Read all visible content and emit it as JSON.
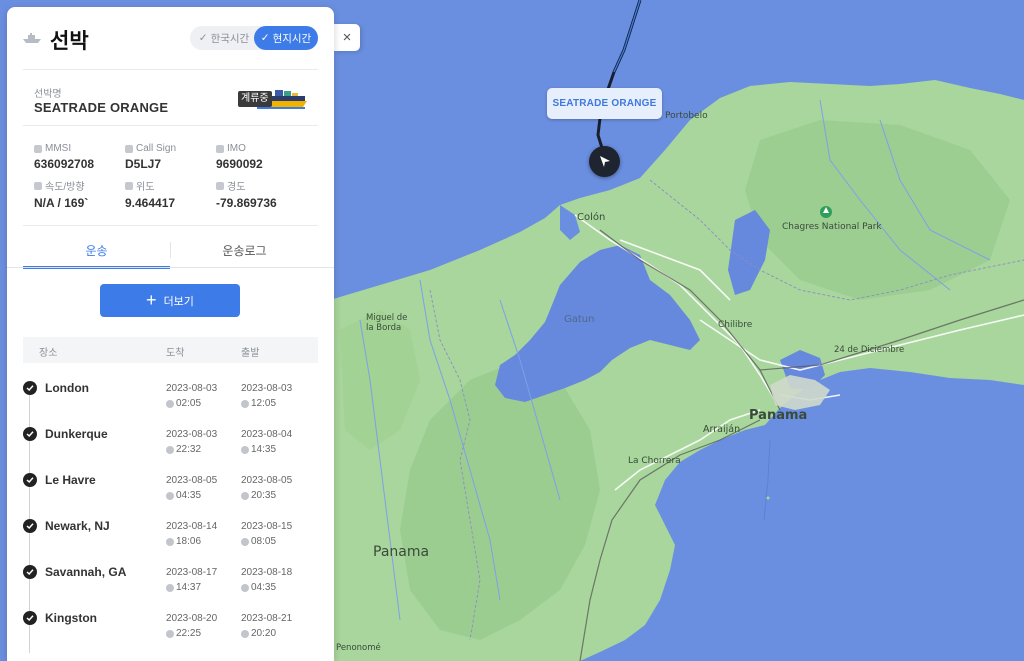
{
  "panel": {
    "title": "선박",
    "time_toggle": {
      "korea": "한국시간",
      "local": "현지시간",
      "selected": "local"
    },
    "close_label": "×",
    "vessel_name_label": "선박명",
    "vessel_name": "SEATRADE ORANGE",
    "status_badge": "계류중",
    "info": {
      "mmsi_label": "MMSI",
      "mmsi": "636092708",
      "callsign_label": "Call Sign",
      "callsign": "D5LJ7",
      "imo_label": "IMO",
      "imo": "9690092",
      "speed_label": "속도/방향",
      "speed": "N/A / 169`",
      "lat_label": "위도",
      "lat": "9.464417",
      "lon_label": "경도",
      "lon": "-79.869736"
    },
    "tabs": [
      {
        "label": "운송",
        "active": true
      },
      {
        "label": "운송로그",
        "active": false
      }
    ],
    "more_button": "더보기",
    "table_headers": {
      "place": "장소",
      "arrival": "도착",
      "departure": "출발"
    },
    "ports": [
      {
        "place": "London",
        "arr_date": "2023-08-03",
        "arr_time": "02:05",
        "dep_date": "2023-08-03",
        "dep_time": "12:05"
      },
      {
        "place": "Dunkerque",
        "arr_date": "2023-08-03",
        "arr_time": "22:32",
        "dep_date": "2023-08-04",
        "dep_time": "14:35"
      },
      {
        "place": "Le Havre",
        "arr_date": "2023-08-05",
        "arr_time": "04:35",
        "dep_date": "2023-08-05",
        "dep_time": "20:35"
      },
      {
        "place": "Newark, NJ",
        "arr_date": "2023-08-14",
        "arr_time": "18:06",
        "dep_date": "2023-08-15",
        "dep_time": "08:05"
      },
      {
        "place": "Savannah, GA",
        "arr_date": "2023-08-17",
        "arr_time": "14:37",
        "dep_date": "2023-08-18",
        "dep_time": "04:35"
      },
      {
        "place": "Kingston",
        "arr_date": "2023-08-20",
        "arr_time": "22:25",
        "dep_date": "2023-08-21",
        "dep_time": "20:20"
      }
    ]
  },
  "map": {
    "ship_label": "SEATRADE ORANGE",
    "places": {
      "portobelo": "Portobelo",
      "colon": "Colón",
      "chagres": "Chagres National Park",
      "miguel": "Miguel de\nla Borda",
      "chilibre": "Chilibre",
      "diciembre": "24 de Diciembre",
      "panama_city": "Panama",
      "arraijan": "Arraiján",
      "chorrera": "La Chorrera",
      "panama_country": "Panama",
      "penonome": "Penonomé",
      "gatun": "Gatun"
    },
    "colors": {
      "sea": "#6b8fe0",
      "land": "#a7d59a",
      "lake": "#6688dd",
      "route": "#1a1f2e",
      "accent": "#3d7ce8"
    }
  }
}
